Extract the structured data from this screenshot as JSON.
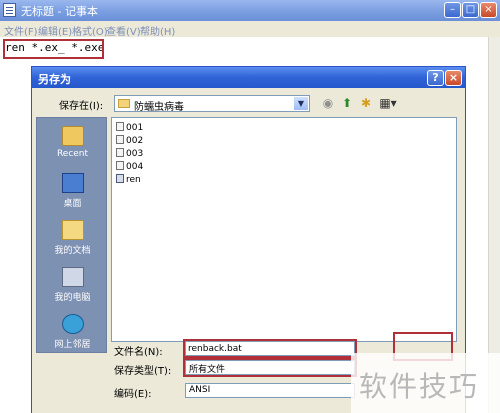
{
  "notepad": {
    "title": "无标题 - 记事本",
    "menu": [
      "文件(F)",
      "编辑(E)",
      "格式(O)",
      "查看(V)",
      "帮助(H)"
    ],
    "content": "ren *.ex_ *.exe",
    "window_buttons": {
      "minimize": "–",
      "maximize": "□",
      "close": "×"
    }
  },
  "dialog": {
    "title": "另存为",
    "help_button": "?",
    "close_button": "×",
    "save_in_label": "保存在(I):",
    "save_in_value": "防蠕虫病毒",
    "toolbar_icons": [
      "back-icon",
      "up-folder-icon",
      "new-folder-icon",
      "view-menu-icon"
    ],
    "places": [
      {
        "label": "Recent",
        "icon": "recent-folder-icon"
      },
      {
        "label": "桌面",
        "icon": "desktop-icon"
      },
      {
        "label": "我的文档",
        "icon": "my-documents-icon"
      },
      {
        "label": "我的电脑",
        "icon": "my-computer-icon"
      },
      {
        "label": "网上邻居",
        "icon": "network-icon"
      }
    ],
    "files": [
      "001",
      "002",
      "003",
      "004",
      "ren"
    ],
    "filename_label": "文件名(N):",
    "filename_value": "renback.bat",
    "filetype_label": "保存类型(T):",
    "filetype_value": "所有文件",
    "encoding_label": "编码(E):",
    "encoding_value": "ANSI"
  },
  "watermark": "软件技巧",
  "colors": {
    "highlight_box": "#b0303a",
    "titlebar": "#2557cc"
  }
}
